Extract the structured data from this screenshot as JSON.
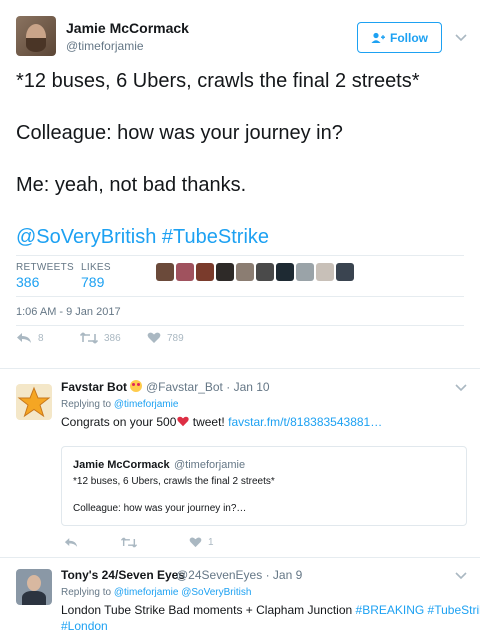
{
  "main_tweet": {
    "author_name": "Jamie McCormack",
    "author_handle": "@timeforjamie",
    "follow_label": "Follow",
    "lines": [
      "*12 buses, 6 Ubers, crawls the final 2 streets*",
      "Colleague: how was your journey in?",
      "Me: yeah, not bad thanks."
    ],
    "mention": "@SoVeryBritish",
    "hashtag": "#TubeStrike",
    "retweets_label": "RETWEETS",
    "retweets_value": "386",
    "likes_label": "LIKES",
    "likes_value": "789",
    "timestamp": "1:06 AM - 9 Jan 2017",
    "actions": {
      "replies": "8",
      "retweets": "386",
      "likes": "789"
    },
    "liker_colors": [
      "#6b4a3a",
      "#a0525e",
      "#7a3b2c",
      "#2e2a28",
      "#8b7d72",
      "#4a4a4a",
      "#1e2a33",
      "#9aa3a8",
      "#c8c0b8",
      "#3a4450"
    ]
  },
  "reply1": {
    "author_name": "Favstar Bot",
    "author_handle": "@Favstar_Bot",
    "date": "Jan 10",
    "replying_prefix": "Replying to",
    "replying_to": "@timeforjamie",
    "text_before": "Congrats on your 500",
    "text_after": " tweet!",
    "link": "favstar.fm/t/818383543881…",
    "quote": {
      "author_name": "Jamie McCormack",
      "author_handle": "@timeforjamie",
      "line1": "*12 buses, 6 Ubers, crawls the final 2 streets*",
      "line2": "Colleague: how was your journey in?…"
    },
    "actions": {
      "likes": "1"
    }
  },
  "reply2": {
    "author_name": "Tony's 24/Seven Eyes",
    "author_handle": "@24SevenEyes",
    "date": "Jan 9",
    "replying_prefix": "Replying to",
    "replying_to": "@timeforjamie @SoVeryBritish",
    "text": "London Tube Strike  Bad moments + Clapham Junction ",
    "hashtags_line1": "#BREAKING #TubeStrike",
    "hashtags_line2": "#London"
  },
  "colors": {
    "accent": "#1da1f2",
    "muted": "#657786",
    "heart": "#e0245e"
  }
}
